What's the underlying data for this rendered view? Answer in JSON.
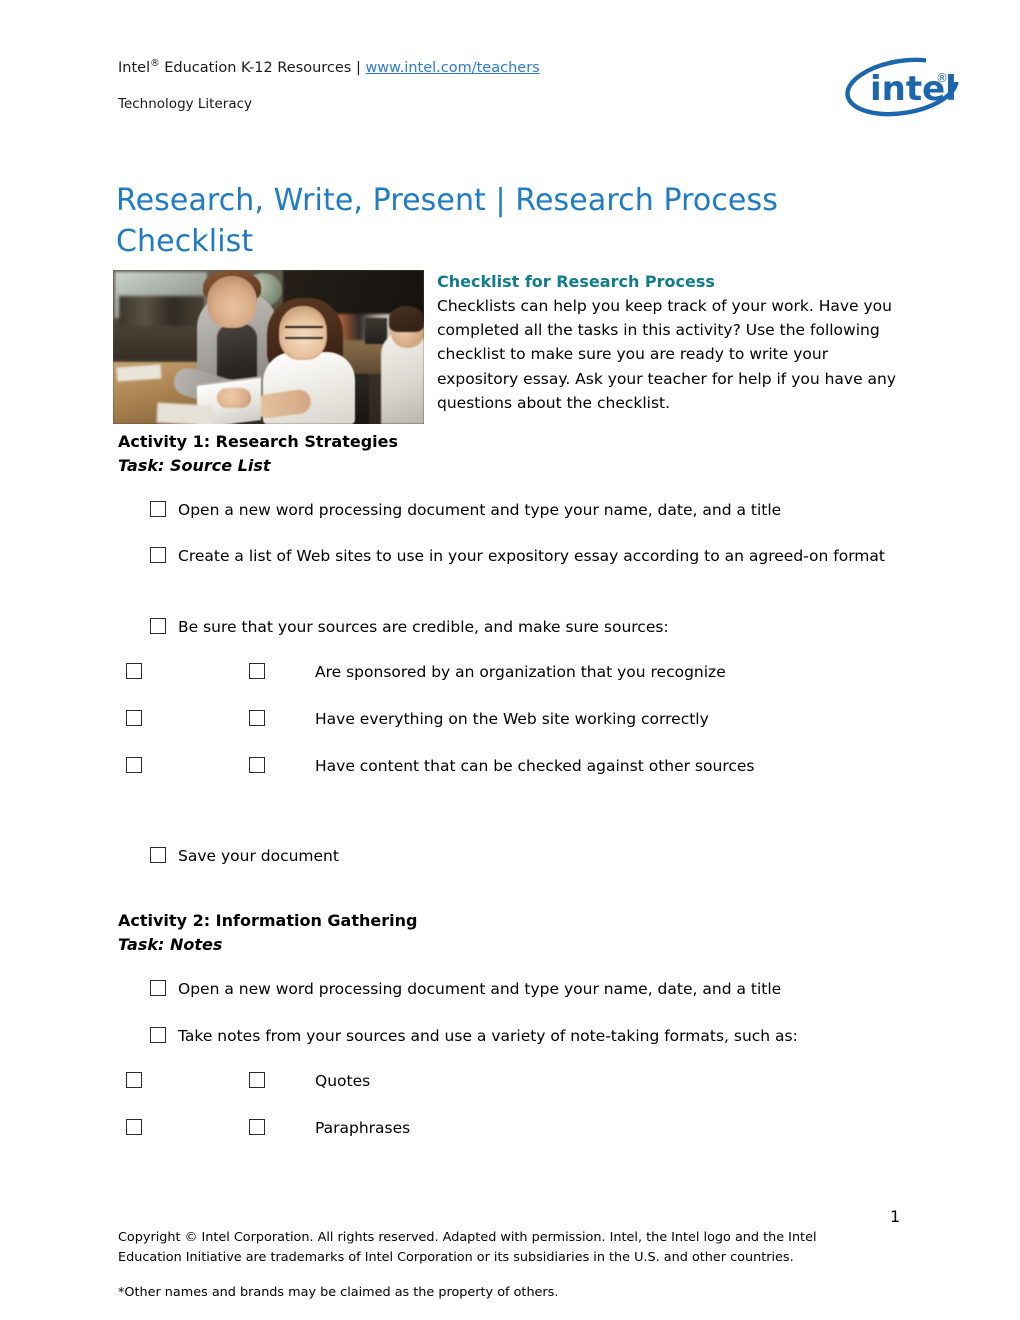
{
  "header": {
    "brand": "Intel",
    "registered_mark": "®",
    "line_rest": " Education K-12 Resources | ",
    "link_text": "www.intel.com/teachers",
    "subtitle": "Technology Literacy",
    "logo_wordmark": "intel",
    "logo_color": "#1b66ad"
  },
  "title": "Research, Write, Present | Research Process Checklist",
  "title_color": "#1f7bc4",
  "intro": {
    "heading": "Checklist for Research Process",
    "heading_color": "#107c8e",
    "body": "Checklists can help you keep track of your work. Have you completed all the tasks in this activity? Use the following checklist to make sure you are ready to write your expository essay. Ask your teacher for help if you have any questions about the checklist."
  },
  "photo": {
    "alt": "Teacher helping a student working on a laptop in a classroom"
  },
  "activities": [
    {
      "heading": "Activity 1: Research Strategies",
      "task": "Task: Source List",
      "items": [
        {
          "level": 1,
          "text": "Open a new word processing document and type your name, date, and a title"
        },
        {
          "level": 1,
          "text": "Create a list of Web sites to use in your expository essay according to an agreed-on format"
        },
        {
          "level": 1,
          "text": "Be sure that your sources are credible, and make sure sources:"
        },
        {
          "level": 2,
          "text": "Are sponsored by an organization that you recognize"
        },
        {
          "level": 2,
          "text": "Have everything on the Web site working correctly"
        },
        {
          "level": 2,
          "text": "Have content that can be checked against other sources"
        },
        {
          "level": 1,
          "text": "Save your document"
        }
      ]
    },
    {
      "heading": "Activity 2: Information Gathering",
      "task": "Task: Notes",
      "items": [
        {
          "level": 1,
          "text": "Open a new word processing document and type your name, date, and a title"
        },
        {
          "level": 1,
          "text": "Take notes from your sources and use a variety of note-taking formats, such as:"
        },
        {
          "level": 2,
          "text": "Quotes"
        },
        {
          "level": 2,
          "text": "Paraphrases"
        }
      ]
    }
  ],
  "footer": {
    "page_number": "1",
    "copyright": "Copyright © Intel Corporation. All rights reserved. Adapted with permission. Intel, the Intel logo and the Intel Education Initiative are trademarks of Intel Corporation or its subsidiaries in the U.S. and other countries.",
    "other_names": "*Other names and brands may be claimed as the property of others."
  }
}
